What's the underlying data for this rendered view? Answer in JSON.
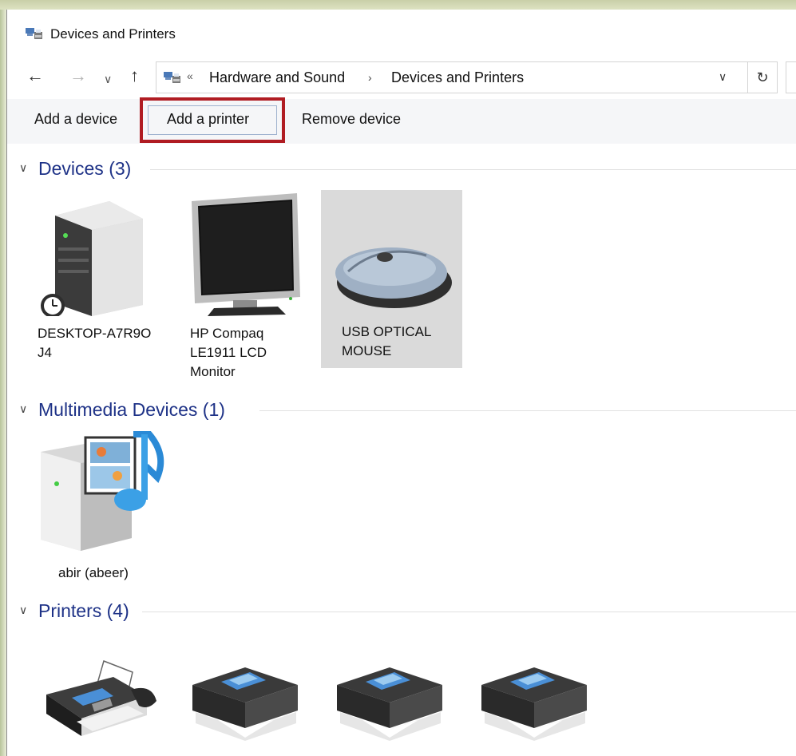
{
  "window": {
    "title": "Devices and Printers"
  },
  "address": {
    "breadcrumb_overflow": "«",
    "parts": [
      "Hardware and Sound",
      "Devices and Printers"
    ],
    "separator": "›"
  },
  "toolbar": {
    "add_device": "Add a device",
    "add_printer": "Add a printer",
    "remove_device": "Remove device"
  },
  "groups": {
    "devices": {
      "label": "Devices (3)",
      "items": [
        {
          "label_line1": "DESKTOP-A7R9O",
          "label_line2": "J4",
          "icon": "computer-tower-icon"
        },
        {
          "label_line1": "HP Compaq",
          "label_line2": "LE1911 LCD",
          "label_line3": "Monitor",
          "icon": "monitor-icon"
        },
        {
          "label_line1": "USB OPTICAL",
          "label_line2": "MOUSE",
          "icon": "mouse-icon",
          "selected": true
        }
      ]
    },
    "multimedia": {
      "label": "Multimedia Devices (1)",
      "items": [
        {
          "label_line1": "abir (abeer)",
          "icon": "media-server-icon"
        }
      ]
    },
    "printers": {
      "label": "Printers (4)",
      "items": [
        {
          "icon": "fax-icon"
        },
        {
          "icon": "printer-icon"
        },
        {
          "icon": "printer-icon"
        },
        {
          "icon": "printer-icon"
        }
      ]
    }
  },
  "colors": {
    "group_header": "#1e3287",
    "highlight_box": "#b01c22",
    "selection": "#dadada",
    "command_bar": "#f5f6f8"
  }
}
